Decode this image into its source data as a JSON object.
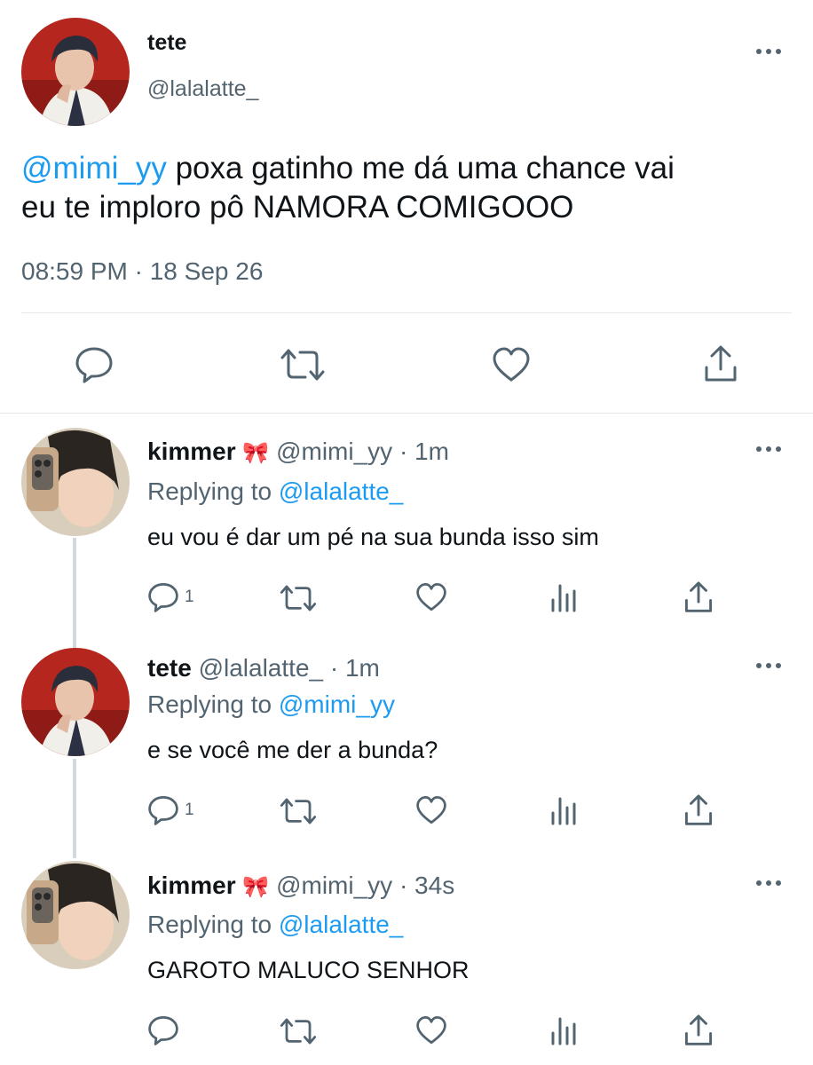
{
  "main_tweet": {
    "name": "tete",
    "handle": "@lalalatte_",
    "mention": "@mimi_yy",
    "text_line1_rest": " poxa gatinho me dá uma chance vai",
    "text_line2": "eu te imploro pô NAMORA COMIGOOO",
    "timestamp": "08:59 PM · 18 Sep 26"
  },
  "replies": [
    {
      "name": "kimmer",
      "emoji": "🎀",
      "handle_time": "@mimi_yy · 1m",
      "replying_prefix": "Replying to ",
      "replying_to": "@lalalatte_",
      "text": "eu vou é dar um pé na sua bunda isso sim",
      "reply_count": "1"
    },
    {
      "name": "tete",
      "emoji": "",
      "handle_time": "@lalalatte_ · 1m",
      "replying_prefix": "Replying to ",
      "replying_to": "@mimi_yy",
      "text": "e se você me der a bunda?",
      "reply_count": "1"
    },
    {
      "name": "kimmer",
      "emoji": "🎀",
      "handle_time": "@mimi_yy · 34s",
      "replying_prefix": "Replying to ",
      "replying_to": "@lalalatte_",
      "text": "GAROTO MALUCO SENHOR",
      "reply_count": ""
    }
  ],
  "icons": {
    "reply": "speech-bubble-icon",
    "retweet": "retweet-arrows-icon",
    "like": "heart-icon",
    "analytics": "bar-chart-icon",
    "share": "share-upload-icon",
    "more": "three-dots-icon"
  },
  "colors": {
    "link": "#1d9bf0",
    "muted": "#536471",
    "text": "#0f1419",
    "divider": "#e6e9eb",
    "thread_line": "#cfd9de",
    "icon": "#536471"
  }
}
